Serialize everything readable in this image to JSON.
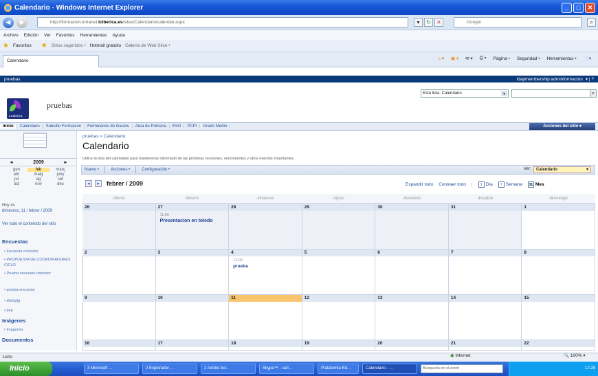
{
  "window": {
    "title": "Calendario - Windows Internet Explorer"
  },
  "browser": {
    "url_prefix": "http://formacion.intranet.",
    "url_domain": "lciberica.es",
    "url_suffix": "/sites/Calendario/calendar.aspx",
    "search_placeholder": "Google",
    "menu": [
      "Archivo",
      "Edición",
      "Ver",
      "Favoritos",
      "Herramientas",
      "Ayuda"
    ],
    "favorites_label": "Favoritos",
    "fav_items": [
      "Sitios sugeridos •",
      "Hotmail gratuito",
      "Galería de Web Slice •"
    ],
    "tab_title": "Calendario",
    "tab_tools": [
      "Página •",
      "Seguridad •",
      "Herramientas •"
    ]
  },
  "sharepoint": {
    "top_left": "pruebas",
    "user": "ldapmembership:adminformacion",
    "logo_text": "LCIberica",
    "site_name": "pruebas",
    "search_scope": "Esta lista: Calendario",
    "nav_tabs": [
      "Inicio",
      "Calendario",
      "Subsitio Formacion",
      "Formularios de Gastos",
      "Area de Primaria",
      "ESO",
      "PCPI",
      "Grado Medio"
    ],
    "site_actions": "Acciones del sitio"
  },
  "leftnav": {
    "year": "2009",
    "months": [
      "gen",
      "feb",
      "març",
      "abr",
      "maig",
      "juny",
      "jul",
      "ag",
      "set",
      "oct",
      "nov",
      "des"
    ],
    "today_label": "Hoy es",
    "today_value": "dimecres, 11 / febrer / 2009",
    "view_all": "Ver todo el contenido del sitio",
    "sections": [
      {
        "title": "Encuestas",
        "items": [
          "Encuesta comedor",
          "PROPUESTA DE COORDINADORES CICLO",
          "Prueba encuesta comedor",
          "prueba encuesta",
          "dfsfdgfg",
          "pep"
        ]
      },
      {
        "title": "Imágenes",
        "items": [
          "Imagenes"
        ]
      },
      {
        "title": "Documentos",
        "items": []
      }
    ]
  },
  "main": {
    "breadcrumb": "pruebas > Calendario",
    "title": "Calendario",
    "description": "Utilice la lista del calendario para mantenerse informado de las próximas reuniones, vencimientos y otros eventos importantes.",
    "toolbar": [
      "Nuevo •",
      "Acciones •",
      "Configuración •"
    ],
    "view_label": "Ver:",
    "view_value": "Calendario",
    "month": "febrer / 2009",
    "expand": "Expandir todo",
    "collapse": "Contraer todo",
    "views": [
      "Día",
      "Semana",
      "Mes"
    ],
    "view_icons": [
      "1",
      "7",
      "31"
    ],
    "daynames": [
      "dilluns",
      "dimarts",
      "dimecres",
      "dijous",
      "divendres",
      "dissabte",
      "diumenge"
    ],
    "weeks": [
      [
        "26",
        "27",
        "28",
        "29",
        "30",
        "31",
        "1"
      ],
      [
        "2",
        "3",
        "4",
        "5",
        "6",
        "7",
        "8"
      ],
      [
        "9",
        "10",
        "11",
        "12",
        "13",
        "14",
        "15"
      ],
      [
        "16",
        "17",
        "18",
        "19",
        "20",
        "21",
        "22"
      ]
    ],
    "events": [
      {
        "time": "11:00",
        "title": "Presentacion en toledo"
      },
      {
        "time": "12:00",
        "title": "prueba"
      }
    ]
  },
  "status": {
    "left": "Listo",
    "zone": "Internet",
    "zoom": "100%"
  },
  "taskbar": {
    "start": "Inicio",
    "items": [
      "3 Microsoft ...",
      "2 Explorador ...",
      "2 Adobe Acr...",
      "Skype™ - carl...",
      "Plataforma Ed...",
      "Calendario - ..."
    ],
    "search": "Búsqueda en el escrit",
    "clock": "12:28"
  }
}
